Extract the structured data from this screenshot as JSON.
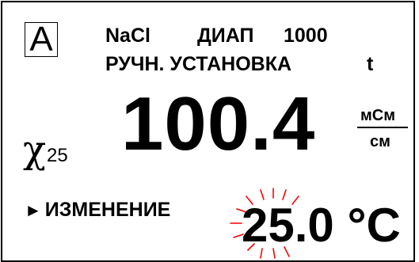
{
  "display": {
    "mode_letter": "A",
    "header_line1": {
      "solution": "NaCl",
      "range_label": "ДИАП",
      "range_value": "1000"
    },
    "header_line2": {
      "mode": "РУЧН. УСТАНОВКА",
      "param": "t"
    },
    "measurement": {
      "symbol": "χ",
      "symbol_subscript": "25",
      "value": "100.4",
      "unit_numerator": "мСм",
      "unit_denominator": "см"
    },
    "action": {
      "arrow": "►",
      "label": "ИЗМЕНЕНИЕ"
    },
    "temperature": {
      "value": "25.0",
      "unit": "°C",
      "blinking": true
    }
  },
  "colors": {
    "background": "#ffffff",
    "foreground": "#000000",
    "blink_rays": "#ff0000"
  }
}
